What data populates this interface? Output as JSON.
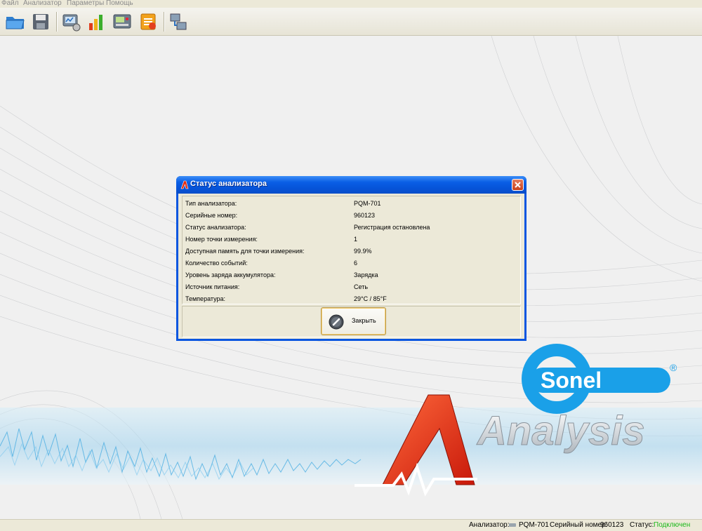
{
  "menu": {
    "items": [
      {
        "label": "Файл"
      },
      {
        "label": "Анализатор"
      },
      {
        "label": "Параметры"
      },
      {
        "label": "Помощь"
      }
    ]
  },
  "toolbar": {
    "buttons": [
      "open-folder-icon",
      "save-disk-icon",
      "analyzer-connect-icon",
      "bar-chart-icon",
      "settings-panel-icon",
      "report-icon",
      "network-icon"
    ]
  },
  "dialog": {
    "title": "Статус анализатора",
    "rows": [
      {
        "label": "Тип анализатора:",
        "value": "PQM-701"
      },
      {
        "label": "Серийные номер:",
        "value": "960123"
      },
      {
        "label": "Статус анализатора:",
        "value": "Регистрация остановлена"
      },
      {
        "label": "Номер точки измерения:",
        "value": "1"
      },
      {
        "label": "Доступная память для точки измерения:",
        "value": "99.9%"
      },
      {
        "label": "Количество событий:",
        "value": "6"
      },
      {
        "label": "Уровень заряда аккумулятора:",
        "value": "Зарядка"
      },
      {
        "label": "Источник питания:",
        "value": "Сеть"
      },
      {
        "label": "Температура:",
        "value": "29°C / 85°F"
      }
    ],
    "close_button_label": "Закрыть"
  },
  "branding": {
    "sonel_logo": "Sonel",
    "registered_mark": "®",
    "analysis_logo": "Analysis",
    "brand_blue": "#1aa0e8",
    "brand_red": "#e62d10"
  },
  "statusbar": {
    "analyzer_label": "Анализатор:",
    "analyzer_value": "PQM-701",
    "serial_label": "Серийный номер:",
    "serial_value": "960123",
    "status_label": "Статус:",
    "status_value": "Подключен",
    "status_color": "#1ab81a"
  }
}
